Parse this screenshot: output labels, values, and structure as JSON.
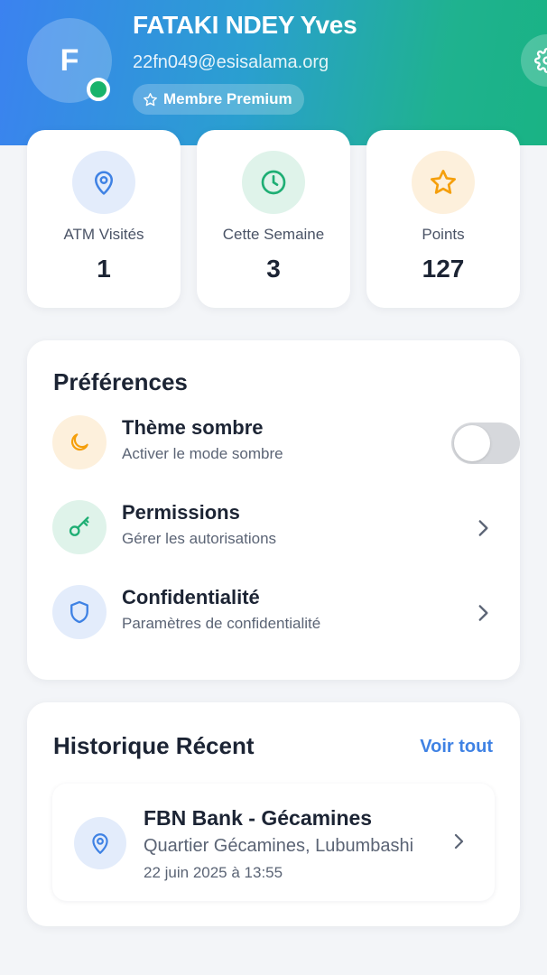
{
  "profile": {
    "initial": "F",
    "name": "FATAKI NDEY Yves",
    "email": "22fn049@esisalama.org",
    "badge": "Membre Premium",
    "status": "online"
  },
  "stats": [
    {
      "label": "ATM Visités",
      "value": "1",
      "icon": "map-pin-icon",
      "color": "#3f82e4"
    },
    {
      "label": "Cette Semaine",
      "value": "3",
      "icon": "clock-icon",
      "color": "#1eae74"
    },
    {
      "label": "Points",
      "value": "127",
      "icon": "star-icon",
      "color": "#f59f0b"
    }
  ],
  "preferences": {
    "title": "Préférences",
    "items": [
      {
        "title": "Thème sombre",
        "subtitle": "Activer le mode sombre",
        "icon": "moon-icon",
        "control": "toggle",
        "enabled": false
      },
      {
        "title": "Permissions",
        "subtitle": "Gérer les autorisations",
        "icon": "key-icon",
        "control": "chevron"
      },
      {
        "title": "Confidentialité",
        "subtitle": "Paramètres de confidentialité",
        "icon": "shield-icon",
        "control": "chevron"
      }
    ]
  },
  "history": {
    "title": "Historique Récent",
    "see_all": "Voir tout",
    "items": [
      {
        "name": "FBN Bank - Gécamines",
        "address": "Quartier Gécamines, Lubumbashi",
        "date": "22 juin 2025 à 13:55",
        "icon": "map-pin-icon"
      }
    ]
  },
  "colors": {
    "header_gradient_start": "#3b82f0",
    "header_gradient_end": "#19b384",
    "accent_blue": "#3f82e4",
    "accent_green": "#1eae74",
    "accent_orange": "#f59f0b"
  }
}
